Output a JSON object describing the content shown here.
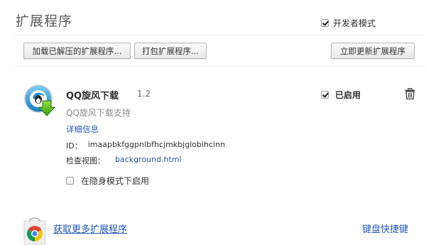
{
  "header": {
    "title": "扩展程序",
    "dev_mode_label": "开发者模式",
    "dev_mode_checked": true
  },
  "toolbar": {
    "load_unpacked": "加载已解压的扩展程序...",
    "pack": "打包扩展程序...",
    "update_now": "立即更新扩展程序"
  },
  "extension": {
    "icon": "qq-whirlwind-download-icon",
    "name": "QQ旋风下载",
    "version": "1.2",
    "description": "QQ旋风下载支持",
    "details_link": "详细信息",
    "id_label": "ID：",
    "id_value": "imaapbkfggpnlbfhcjmkbjglobihcinn",
    "inspect_label": "检查视图：",
    "inspect_link": "background.html",
    "incognito_label": "在隐身模式下启用",
    "incognito_checked": false,
    "enabled_label": "已启用",
    "enabled_checked": true,
    "remove_icon": "trash-icon"
  },
  "footer": {
    "store_icon": "chrome-web-store-icon",
    "more_extensions": "获取更多扩展程序",
    "keyboard_shortcuts": "键盘快捷键"
  },
  "colors": {
    "link": "#2259b4",
    "title": "#5a5a5a"
  }
}
